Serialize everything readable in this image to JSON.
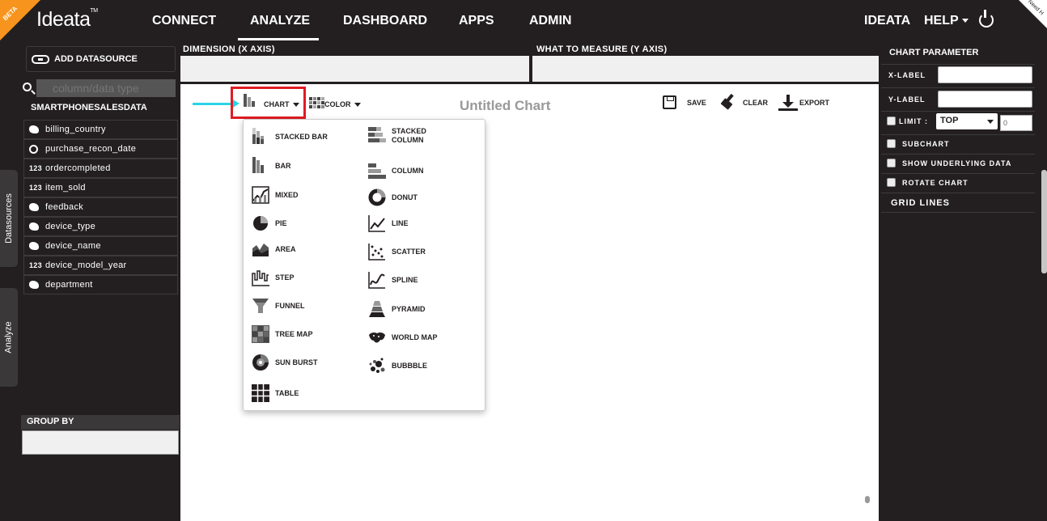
{
  "nav": {
    "beta": "BETA",
    "logo": "Ideata",
    "logo_tm": "TM",
    "items": [
      "CONNECT",
      "ANALYZE",
      "DASHBOARD",
      "APPS",
      "ADMIN"
    ],
    "active": "ANALYZE",
    "user": "IDEATA",
    "help": "HELP",
    "need_help": "Need H"
  },
  "left": {
    "add_datasource": "ADD DATASOURCE",
    "search_placeholder": "column/data type",
    "datasource_title": "SMARTPHONESALESDATA",
    "fields": [
      {
        "icon": "geo-icon",
        "name": "billing_country"
      },
      {
        "icon": "clock-icon",
        "name": "purchase_recon_date"
      },
      {
        "icon": "number-icon",
        "name": "ordercompleted"
      },
      {
        "icon": "number-icon",
        "name": "item_sold"
      },
      {
        "icon": "geo-icon",
        "name": "feedback"
      },
      {
        "icon": "geo-icon",
        "name": "device_type"
      },
      {
        "icon": "geo-icon",
        "name": "device_name"
      },
      {
        "icon": "number-icon",
        "name": "device_model_year"
      },
      {
        "icon": "geo-icon",
        "name": "department"
      }
    ],
    "number_icon_text": "123",
    "tab_datasources": "Datasources",
    "tab_analyze": "Analyze",
    "group_by": "GROUP BY"
  },
  "center": {
    "dimension_label": "DIMENSION (X AXIS)",
    "measure_label": "WHAT TO MEASURE (Y AXIS)",
    "chart_btn": "CHART",
    "color_btn": "COLOR",
    "chart_title": "Untitled Chart",
    "save": "SAVE",
    "clear": "CLEAR",
    "export": "EXPORT"
  },
  "chart_types": {
    "left": [
      "STACKED BAR",
      "BAR",
      "MIXED",
      "PIE",
      "AREA",
      "STEP",
      "FUNNEL",
      "TREE MAP",
      "SUN BURST",
      "TABLE"
    ],
    "right_stacked_column_1": "STACKED",
    "right_stacked_column_2": "COLUMN",
    "right": [
      "COLUMN",
      "DONUT",
      "LINE",
      "SCATTER",
      "SPLINE",
      "PYRAMID",
      "WORLD MAP",
      "BUBBBLE"
    ]
  },
  "right": {
    "title": "CHART PARAMETER",
    "x_label": "X-LABEL",
    "y_label": "Y-LABEL",
    "limit": "LIMIT :",
    "limit_select": "TOP",
    "limit_value": "0",
    "subchart": "SUBCHART",
    "show_underlying": "SHOW UNDERLYING DATA",
    "rotate": "ROTATE CHART",
    "grid_lines": "GRID LINES"
  }
}
